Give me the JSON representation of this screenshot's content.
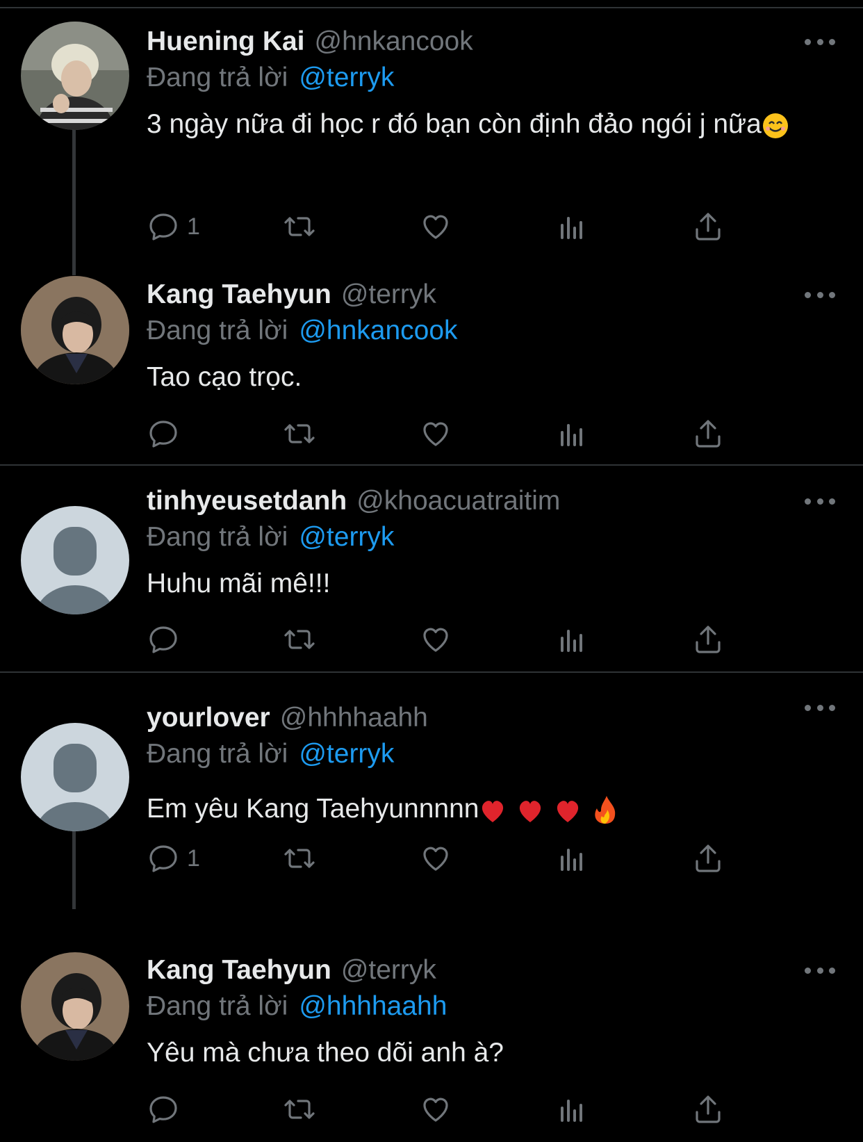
{
  "colors": {
    "background": "#000000",
    "text": "#e7e9ea",
    "muted": "#71767b",
    "link": "#1d9bf0",
    "divider": "#2f3336"
  },
  "reply_prefix": "Đang trả lời",
  "tweets": [
    {
      "name": "Huening Kai",
      "handle": "@hnkancook",
      "reply_to": "@terryk",
      "text": "3 ngày nữa đi học r đó bạn còn định đảo ngói j nữa",
      "text_emoji": "smiling-face-emoji",
      "reply_count": "1",
      "avatar": "photo-avatar-blonde"
    },
    {
      "name": "Kang Taehyun",
      "handle": "@terryk",
      "reply_to": "@hnkancook",
      "text": "Tao cạo trọc.",
      "reply_count": "",
      "avatar": "photo-avatar-dark"
    },
    {
      "name": "tinhyeusetdanh",
      "handle": "@khoacuatraitim",
      "reply_to": "@terryk",
      "text": "Huhu mãi mê!!!",
      "reply_count": "",
      "avatar": "default-avatar"
    },
    {
      "name": "yourlover",
      "handle": "@hhhhaahh",
      "reply_to": "@terryk",
      "text": "Em yêu Kang Taehyunnnnn",
      "text_emoji": "hearts-and-fire-emoji",
      "reply_count": "1",
      "avatar": "default-avatar"
    },
    {
      "name": "Kang Taehyun",
      "handle": "@terryk",
      "reply_to": "@hhhhaahh",
      "text": "Yêu mà chưa theo dõi anh à?",
      "reply_count": "",
      "avatar": "photo-avatar-dark"
    }
  ],
  "action_icons": [
    "reply-icon",
    "retweet-icon",
    "like-icon",
    "views-icon",
    "share-icon"
  ]
}
